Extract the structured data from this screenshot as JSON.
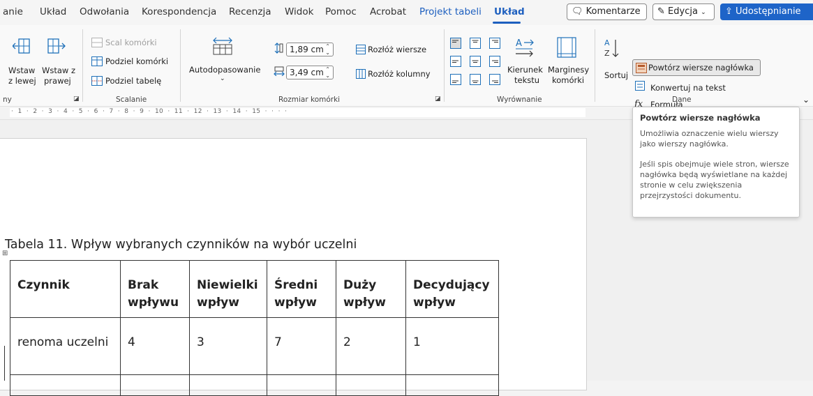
{
  "menu": {
    "tabs": [
      "anie",
      "Układ",
      "Odwołania",
      "Korespondencja",
      "Recenzja",
      "Widok",
      "Pomoc",
      "Acrobat",
      "Projekt tabeli",
      "Układ"
    ],
    "comments_label": "Komentarze",
    "editing_label": "Edycja",
    "share_label": "Udostępnianie"
  },
  "ribbon": {
    "insert_left_l1": "Wstaw",
    "insert_left_l2": "z lewej",
    "insert_right_l1": "Wstaw z",
    "insert_right_l2": "prawej",
    "group_rows_partial": "ny",
    "merge_cells": "Scal komórki",
    "split_cells": "Podziel komórki",
    "split_table": "Podziel tabelę",
    "group_merge": "Scalanie",
    "autofit": "Autodopasowanie",
    "row_height": "1,89 cm",
    "col_width": "3,49 cm",
    "distribute_rows": "Rozłóż wiersze",
    "distribute_cols": "Rozłóż kolumny",
    "group_cell_size": "Rozmiar komórki",
    "text_direction_l1": "Kierunek",
    "text_direction_l2": "tekstu",
    "cell_margins_l1": "Marginesy",
    "cell_margins_l2": "komórki",
    "group_alignment": "Wyrównanie",
    "sort": "Sortuj",
    "repeat_header": "Powtórz wiersze nagłówka",
    "convert_text": "Konwertuj na tekst",
    "formula": "Formuła",
    "group_data": "Dane"
  },
  "ruler_text": "·  1  ·  2  ·  3  ·  4  ·  5  ·  6  ·  7  ·  8  ·  9  ·  10  ·  11  ·  12  ·  13  ·  14  ·  15  ·  ·  ·  ·",
  "tooltip": {
    "title": "Powtórz wiersze nagłówka",
    "para1": "Umożliwia oznaczenie wielu wierszy jako wierszy nagłówka.",
    "para2": "Jeśli spis obejmuje wiele stron, wiersze nagłówka będą wyświetlane na każdej stronie w celu zwiększenia przejrzystości dokumentu."
  },
  "document": {
    "caption": "Tabela 11. Wpływ wybranych czynników na wybór uczelni",
    "table": {
      "headers": [
        [
          "Czynnik",
          ""
        ],
        [
          "Brak",
          "wpływu"
        ],
        [
          "Niewielki",
          "wpływ"
        ],
        [
          "Średni",
          "wpływ"
        ],
        [
          "Duży",
          "wpływ"
        ],
        [
          "Decydujący",
          "wpływ"
        ]
      ],
      "rows": [
        [
          "renoma uczelni",
          "4",
          "3",
          "7",
          "2",
          "1"
        ]
      ]
    }
  },
  "colors": {
    "accent": "#1d5fbf",
    "share_bg": "#1e64c8"
  }
}
